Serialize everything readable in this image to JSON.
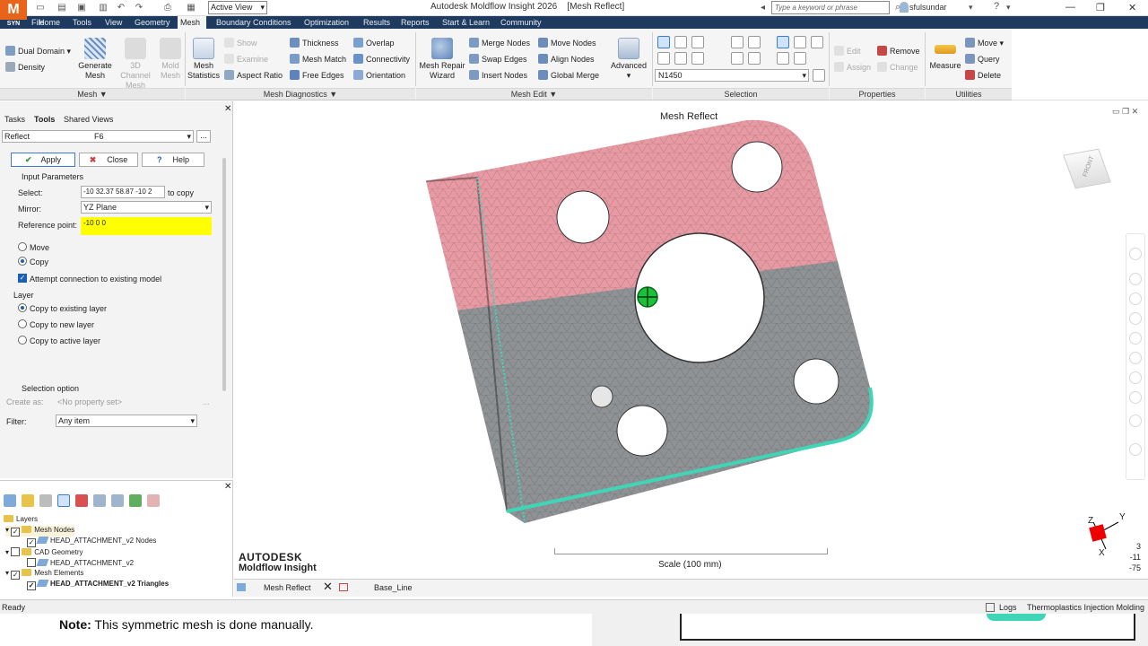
{
  "app": {
    "logo_letter": "M",
    "logo_sub": "SYN",
    "title": "Autodesk Moldflow Insight 2026",
    "doc_title": "[Mesh Reflect]",
    "active_view": "Active View",
    "search_placeholder": "Type a keyword or phrase",
    "user": "sfulsundar"
  },
  "menu": [
    "File",
    "Home",
    "Tools",
    "View",
    "Geometry",
    "Mesh",
    "Boundary Conditions",
    "Optimization",
    "Results",
    "Reports",
    "Start & Learn",
    "Community"
  ],
  "ribbon": {
    "mesh": {
      "dual_domain": "Dual Domain",
      "density": "Density",
      "generate": "Generate",
      "generate2": "Mesh",
      "channel": "3D Channel",
      "channel2": "Mesh",
      "mold": "Mold",
      "mold2": "Mesh",
      "footer": "Mesh ▼"
    },
    "diag": {
      "stats": "Mesh",
      "stats2": "Statistics",
      "show": "Show",
      "examine": "Examine",
      "thickness": "Thickness",
      "mesh_match": "Mesh Match",
      "aspect": "Aspect Ratio",
      "free_edges": "Free Edges",
      "overlap": "Overlap",
      "connectivity": "Connectivity",
      "orientation": "Orientation",
      "footer": "Mesh Diagnostics ▼"
    },
    "edit": {
      "repair": "Mesh Repair",
      "repair2": "Wizard",
      "merge": "Merge Nodes",
      "swap": "Swap Edges",
      "insert": "Insert Nodes",
      "move_nodes": "Move Nodes",
      "align": "Align Nodes",
      "global": "Global Merge",
      "advanced": "Advanced",
      "footer": "Mesh Edit ▼"
    },
    "selection": {
      "combo": "N1450",
      "footer": "Selection"
    },
    "props": {
      "edit": "Edit",
      "assign": "Assign",
      "remove": "Remove",
      "change": "Change",
      "footer": "Properties"
    },
    "util": {
      "measure": "Measure",
      "move": "Move",
      "query": "Query",
      "delete": "Delete",
      "footer": "Utilities"
    }
  },
  "panel": {
    "tabs": [
      "Tasks",
      "Tools",
      "Shared Views"
    ],
    "tool_name": "Reflect",
    "shortcut": "F6",
    "more": "...",
    "apply": "Apply",
    "close": "Close",
    "help": "Help",
    "input_params": "Input Parameters",
    "select_label": "Select:",
    "select_value": "-10 32.37 58.87  -10 2",
    "to_copy": "to copy",
    "mirror_label": "Mirror:",
    "mirror_value": "YZ Plane",
    "ref_label": "Reference point:",
    "ref_value": "-10 0 0",
    "move": "Move",
    "copy": "Copy",
    "attempt": "Attempt connection to existing model",
    "layer_heading": "Layer",
    "copy_existing": "Copy to existing layer",
    "copy_new": "Copy to new layer",
    "copy_active": "Copy to active layer",
    "sel_option": "Selection option",
    "create_as": "Create as:",
    "no_prop": "<No property set>",
    "filter_label": "Filter:",
    "filter_value": "Any item"
  },
  "layers": {
    "root": "Layers",
    "items": [
      {
        "label": "Mesh Nodes",
        "checked": true,
        "type": "folder"
      },
      {
        "label": "HEAD_ATTACHMENT_v2 Nodes",
        "checked": true,
        "type": "layer"
      },
      {
        "label": "CAD Geometry",
        "checked": false,
        "type": "folder"
      },
      {
        "label": "HEAD_ATTACHMENT_v2",
        "checked": false,
        "type": "layer"
      },
      {
        "label": "Mesh Elements",
        "checked": true,
        "type": "folder"
      },
      {
        "label": "HEAD_ATTACHMENT_v2 Triangles",
        "checked": true,
        "type": "layer"
      }
    ]
  },
  "viewport": {
    "title": "Mesh Reflect",
    "brand1": "AUTODESK",
    "brand2": "Moldflow Insight",
    "scale": "Scale (100 mm)",
    "viewcube": "FRONT",
    "axes": {
      "z": "Z",
      "y": "Y",
      "x": "X"
    },
    "coords": [
      "3",
      "-11",
      "-75"
    ],
    "colors": {
      "top": "#e79aa3",
      "bottom": "#8f9294",
      "edge": "#3fd6b8",
      "marker": "#19c23a"
    }
  },
  "doctabs": [
    "Mesh Reflect",
    "Base_Line"
  ],
  "status": {
    "left": "Ready",
    "logs": "Logs",
    "mode": "Thermoplastics Injection Molding"
  },
  "caption": {
    "bold": "Note:",
    "text": " This symmetric mesh is done manually."
  }
}
